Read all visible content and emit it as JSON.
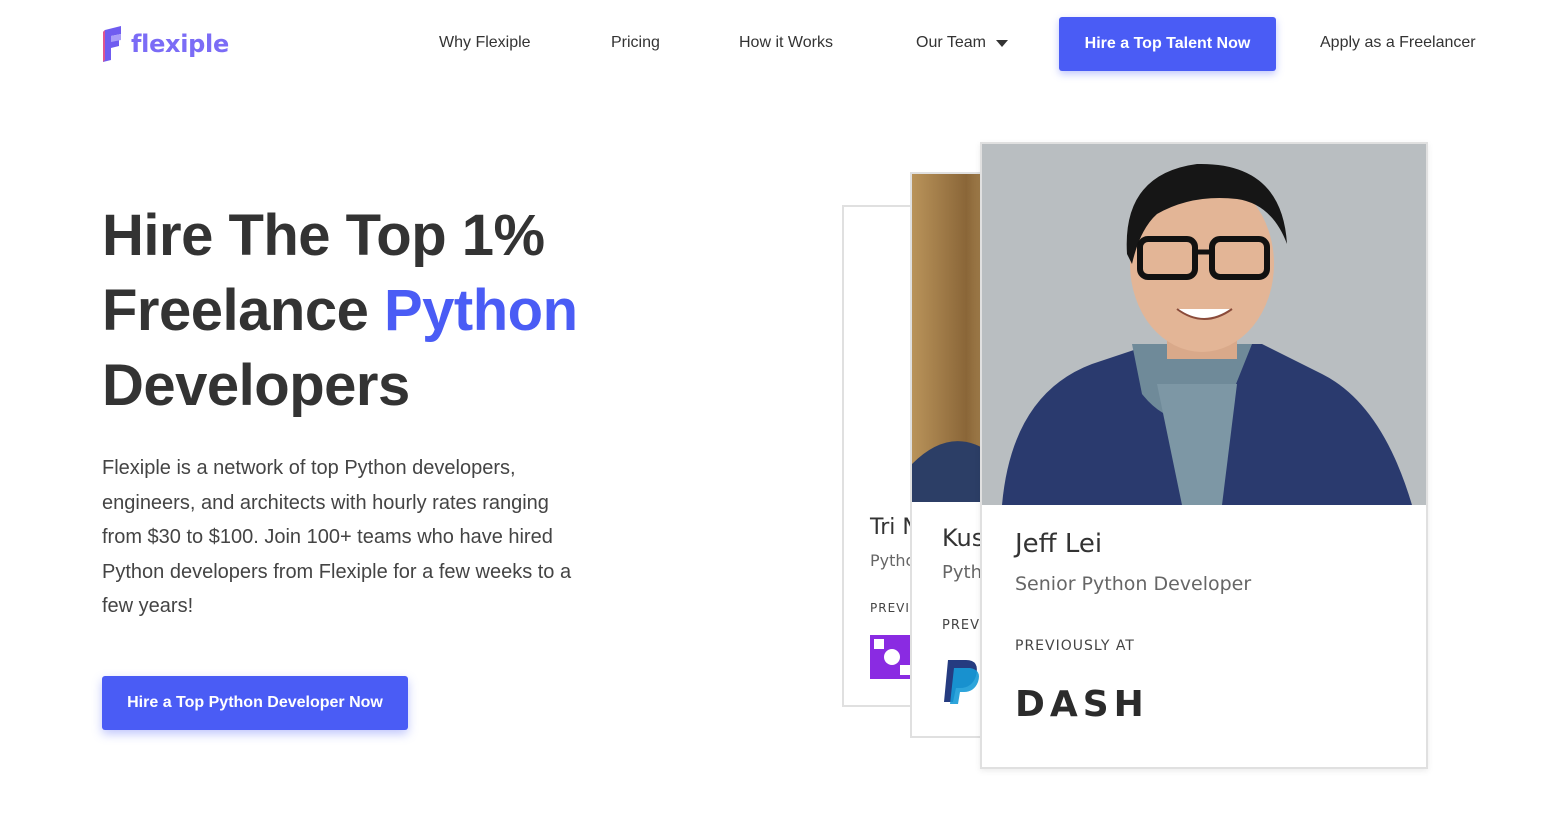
{
  "nav": {
    "logo_text": "flexiple",
    "links": [
      "Why Flexiple",
      "Pricing",
      "How it Works",
      "Our Team"
    ],
    "cta": "Hire a Top Talent Now",
    "apply": "Apply as a Freelancer"
  },
  "hero": {
    "title_line1": "Hire The Top 1%",
    "title_line2_prefix": "Freelance ",
    "title_accent": "Python",
    "title_line3": "Developers",
    "description": "Flexiple is a network of top Python developers, engineers, and architects with hourly rates ranging from $30 to $100. Join 100+ teams who have hired Python developers from Flexiple for a few weeks to a few years!",
    "cta": "Hire a Top Python Developer Now"
  },
  "cards": [
    {
      "name": "Tri N",
      "role": "Pytho",
      "prev": "PREVI"
    },
    {
      "name": "Kus",
      "role": "Pyth",
      "prev": "PREV"
    },
    {
      "name": "Jeff Lei",
      "role": "Senior Python Developer",
      "prev": "PREVIOUSLY AT",
      "company": "DASH"
    }
  ],
  "colors": {
    "accent": "#4a5cf5",
    "logo": "#7b6cf6"
  }
}
